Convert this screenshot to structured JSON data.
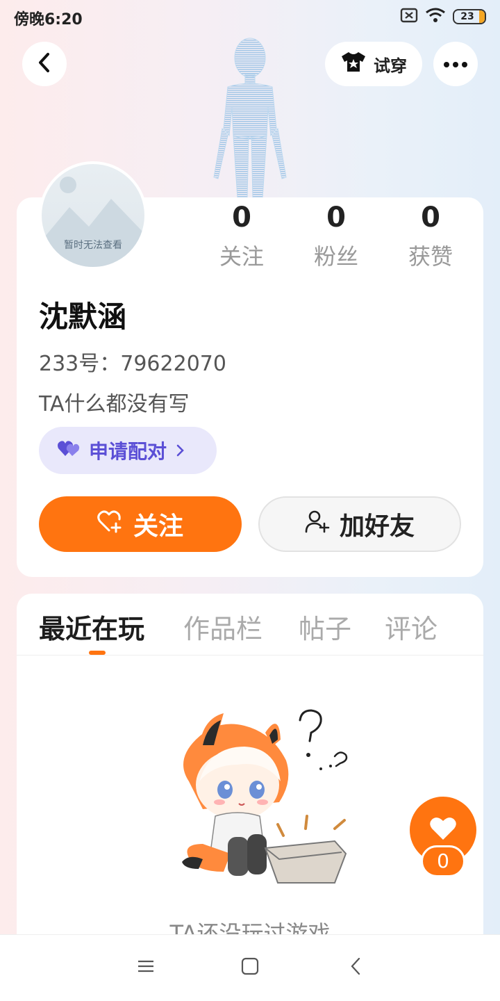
{
  "status_bar": {
    "time": "傍晚6:20",
    "battery": "23"
  },
  "header": {
    "try_on_label": "试穿"
  },
  "avatar": {
    "caption": "暂时无法查看"
  },
  "stats": [
    {
      "value": "0",
      "label": "关注"
    },
    {
      "value": "0",
      "label": "粉丝"
    },
    {
      "value": "0",
      "label": "获赞"
    }
  ],
  "profile": {
    "name": "沈默涵",
    "uid": "233号：79622070",
    "bio": "TA什么都没有写",
    "pair_label": "申请配对"
  },
  "actions": {
    "follow_label": "关注",
    "add_friend_label": "加好友"
  },
  "tabs": [
    {
      "label": "最近在玩",
      "active": true
    },
    {
      "label": "作品栏",
      "active": false
    },
    {
      "label": "帖子",
      "active": false
    },
    {
      "label": "评论",
      "active": false
    }
  ],
  "empty_state": {
    "text": "TA还没玩过游戏"
  },
  "floating_like": {
    "count": "0"
  },
  "colors": {
    "accent": "#ff7410",
    "pair_purple": "#5b4fd6",
    "pair_bg": "#e9e8fb"
  }
}
